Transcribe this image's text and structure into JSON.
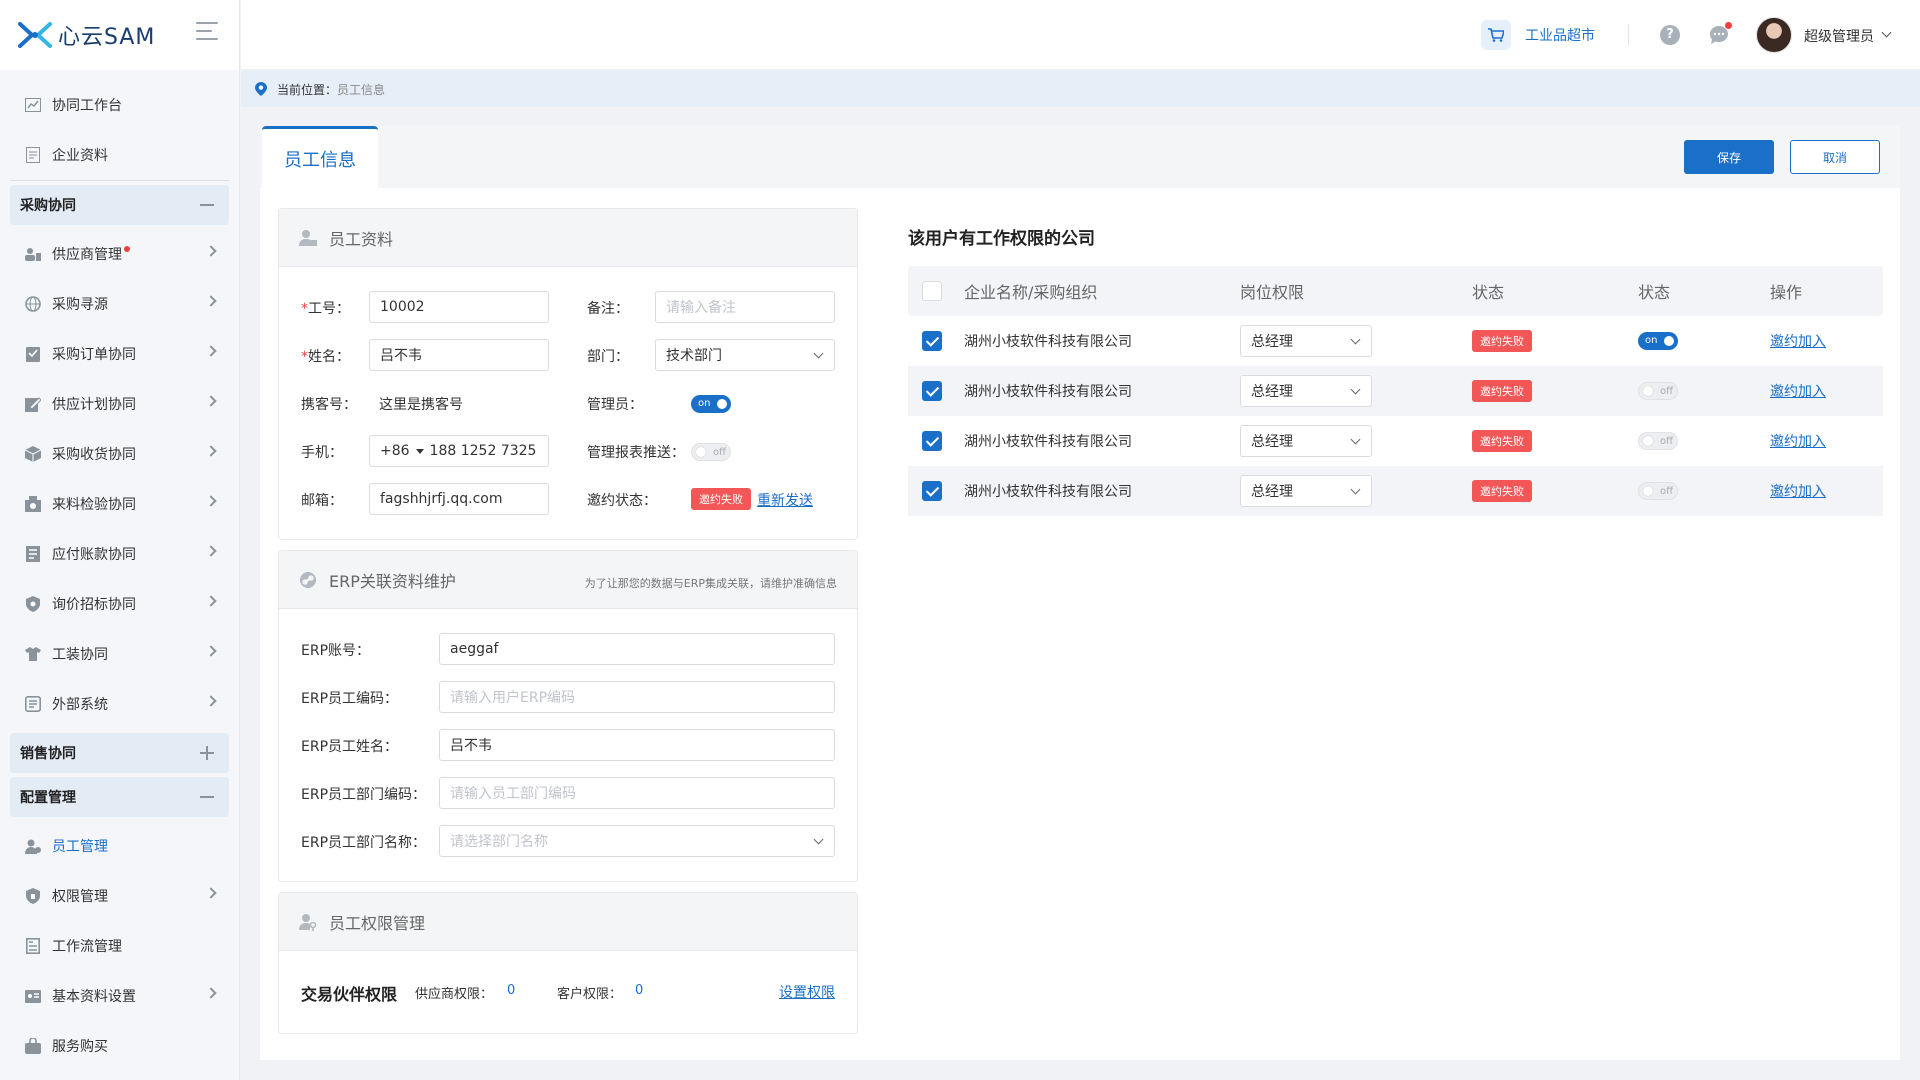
{
  "app": {
    "logo_text": "心云SAM"
  },
  "sidebar": {
    "items_top": [
      {
        "label": "协同工作台",
        "icon": "chart-icon"
      },
      {
        "label": "企业资料",
        "icon": "document-icon"
      }
    ],
    "group_purchase": {
      "label": "采购协同",
      "state": "expanded"
    },
    "items_purchase": [
      {
        "label": "供应商管理",
        "icon": "supplier-icon",
        "has_dot": true
      },
      {
        "label": "采购寻源",
        "icon": "globe-icon"
      },
      {
        "label": "采购订单协同",
        "icon": "clipboard-icon"
      },
      {
        "label": "供应计划协同",
        "icon": "edit-icon"
      },
      {
        "label": "采购收货协同",
        "icon": "box-icon"
      },
      {
        "label": "来料检验协同",
        "icon": "inspect-icon"
      },
      {
        "label": "应付账款协同",
        "icon": "invoice-icon"
      },
      {
        "label": "询价招标协同",
        "icon": "shield-icon"
      },
      {
        "label": "工装协同",
        "icon": "shirt-icon"
      },
      {
        "label": "外部系统",
        "icon": "system-icon"
      }
    ],
    "group_sales": {
      "label": "销售协同",
      "state": "collapsed"
    },
    "group_config": {
      "label": "配置管理",
      "state": "expanded"
    },
    "items_config": [
      {
        "label": "员工管理",
        "icon": "employee-icon",
        "active": true
      },
      {
        "label": "权限管理",
        "icon": "permission-icon"
      },
      {
        "label": "工作流管理",
        "icon": "workflow-icon"
      },
      {
        "label": "基本资料设置",
        "icon": "settings-card-icon"
      },
      {
        "label": "服务购买",
        "icon": "bag-icon"
      }
    ]
  },
  "topbar": {
    "shop_label": "工业品超市",
    "help_glyph": "?",
    "user_name": "超级管理员"
  },
  "breadcrumb": {
    "prefix": "当前位置：",
    "current": "员工信息"
  },
  "tab": {
    "label": "员工信息"
  },
  "actions": {
    "save": "保存",
    "cancel": "取消"
  },
  "employee": {
    "section_title": "员工资料",
    "id_label": "工号：",
    "id_value": "10002",
    "remark_label": "备注：",
    "remark_placeholder": "请输入备注",
    "name_label": "姓名：",
    "name_value": "吕不韦",
    "dept_label": "部门：",
    "dept_value": "技术部门",
    "guest_label": "携客号：",
    "guest_value": "这里是携客号",
    "admin_label": "管理员：",
    "admin_toggle": "on",
    "phone_label": "手机：",
    "phone_code": "+86",
    "phone_value": "188 1252 7325",
    "report_label": "管理报表推送：",
    "report_toggle": "off",
    "email_label": "邮箱：",
    "email_value": "fagshhjrfj.qq.com",
    "invite_label": "邀约状态：",
    "invite_status": "邀约失败",
    "resend": "重新发送",
    "required_mark": "*"
  },
  "erp": {
    "section_title": "ERP关联资料维护",
    "hint": "为了让那您的数据与ERP集成关联，请维护准确信息",
    "account_label": "ERP账号：",
    "account_value": "aeggaf",
    "code_label": "ERP员工编码：",
    "code_placeholder": "请输入用户ERP编码",
    "name_label": "ERP员工姓名：",
    "name_value": "吕不韦",
    "dept_code_label": "ERP员工部门编码：",
    "dept_code_placeholder": "请输入员工部门编码",
    "dept_name_label": "ERP员工部门名称：",
    "dept_name_placeholder": "请选择部门名称"
  },
  "permission": {
    "section_title": "员工权限管理",
    "partner_label": "交易伙伴权限",
    "supplier_label": "供应商权限：",
    "supplier_value": "0",
    "customer_label": "客户权限：",
    "customer_value": "0",
    "set_link": "设置权限"
  },
  "companies": {
    "title": "该用户有工作权限的公司",
    "headers": [
      "企业名称/采购组织",
      "岗位权限",
      "状态",
      "状态",
      "操作"
    ],
    "rows": [
      {
        "name": "湖州小枝软件科技有限公司",
        "role": "总经理",
        "invite": "邀约失败",
        "toggle": "on",
        "action": "邀约加入",
        "checked": true
      },
      {
        "name": "湖州小枝软件科技有限公司",
        "role": "总经理",
        "invite": "邀约失败",
        "toggle": "off",
        "action": "邀约加入",
        "checked": true
      },
      {
        "name": "湖州小枝软件科技有限公司",
        "role": "总经理",
        "invite": "邀约失败",
        "toggle": "off",
        "action": "邀约加入",
        "checked": true
      },
      {
        "name": "湖州小枝软件科技有限公司",
        "role": "总经理",
        "invite": "邀约失败",
        "toggle": "off",
        "action": "邀约加入",
        "checked": true
      }
    ]
  },
  "colors": {
    "accent": "#1a6fc9",
    "danger": "#f25656",
    "sidebar_bg": "#f4f6f9"
  }
}
